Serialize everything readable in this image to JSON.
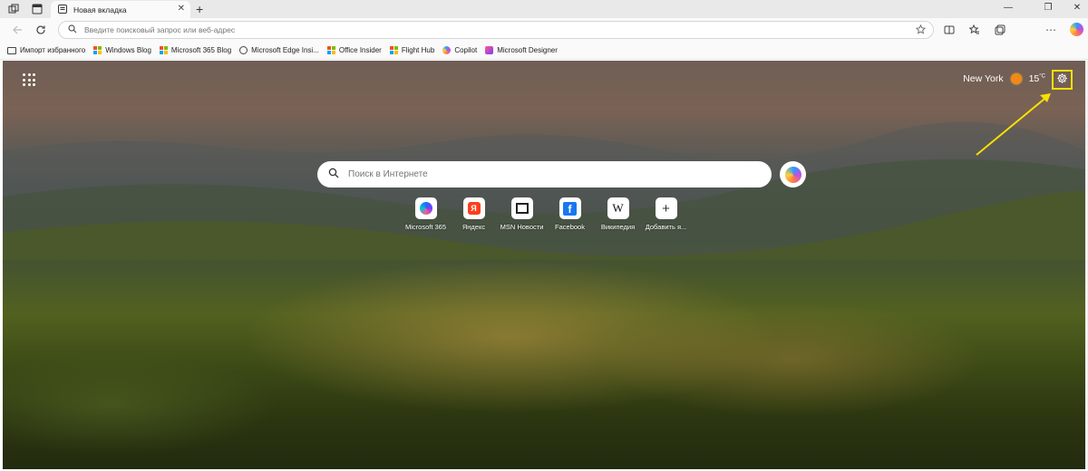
{
  "tabstrip": {
    "tab_title": "Новая вкладка",
    "icons": [
      "workspaces-icon",
      "tab-actions-icon",
      "new-tab-icon",
      "close-icon"
    ]
  },
  "toolbar": {
    "address_placeholder": "Введите поисковый запрос или веб-адрес"
  },
  "favorites": [
    {
      "label": "Импорт избранного",
      "icon": "folder-icon"
    },
    {
      "label": "Windows Blog",
      "icon": "microsoft-logo-icon"
    },
    {
      "label": "Microsoft 365 Blog",
      "icon": "microsoft-logo-icon"
    },
    {
      "label": "Microsoft Edge Insi...",
      "icon": "globe-icon"
    },
    {
      "label": "Office Insider",
      "icon": "microsoft-logo-icon"
    },
    {
      "label": "Flight Hub",
      "icon": "microsoft-logo-icon"
    },
    {
      "label": "Copilot",
      "icon": "copilot-icon"
    },
    {
      "label": "Microsoft Designer",
      "icon": "designer-icon"
    }
  ],
  "newtab": {
    "weather": {
      "city": "New York",
      "temperature": "15",
      "unit": "°C"
    },
    "search_placeholder": "Поиск в Интернете",
    "quick_links": [
      {
        "label": "Microsoft 365"
      },
      {
        "label": "Яндекс"
      },
      {
        "label": "MSN Новости"
      },
      {
        "label": "Facebook"
      },
      {
        "label": "Википедия"
      },
      {
        "label": "Добавить я..."
      }
    ],
    "accent_colors": {
      "highlight": "#f7e000",
      "sun": "#f08a14"
    }
  }
}
